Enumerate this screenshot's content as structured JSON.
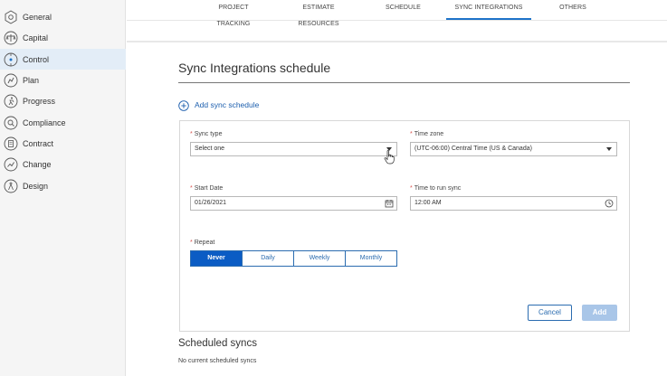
{
  "sidebar": {
    "items": [
      {
        "label": "General",
        "icon": "gear-icon"
      },
      {
        "label": "Capital",
        "icon": "scale-icon"
      },
      {
        "label": "Control",
        "icon": "target-icon",
        "active": true
      },
      {
        "label": "Plan",
        "icon": "route-icon"
      },
      {
        "label": "Progress",
        "icon": "running-icon"
      },
      {
        "label": "Compliance",
        "icon": "search-doc-icon"
      },
      {
        "label": "Contract",
        "icon": "contract-icon"
      },
      {
        "label": "Change",
        "icon": "change-icon"
      },
      {
        "label": "Design",
        "icon": "compass-icon"
      }
    ]
  },
  "tabs": [
    {
      "label": "PROJECT TRACKING"
    },
    {
      "label": "ESTIMATE RESOURCES"
    },
    {
      "label": "SCHEDULE"
    },
    {
      "label": "SYNC INTEGRATIONS",
      "active": true
    },
    {
      "label": "OTHERS"
    }
  ],
  "page": {
    "title": "Sync Integrations schedule",
    "add_label": "Add sync schedule"
  },
  "form": {
    "sync_type": {
      "label": "Sync type",
      "value": "Select one"
    },
    "time_zone": {
      "label": "Time zone",
      "value": "(UTC-06:00) Central Time (US & Canada)"
    },
    "start_date": {
      "label": "Start Date",
      "value": "01/26/2021"
    },
    "time_to_run": {
      "label": "Time to run sync",
      "value": "12:00 AM"
    },
    "repeat": {
      "label": "Repeat",
      "options": [
        "Never",
        "Daily",
        "Weekly",
        "Monthly"
      ],
      "selected": "Never"
    },
    "cancel_label": "Cancel",
    "add_label": "Add"
  },
  "scheduled": {
    "title": "Scheduled syncs",
    "empty_text": "No current scheduled syncs"
  },
  "colors": {
    "accent": "#0b5cc4",
    "link": "#1d5fae",
    "required": "#d9534f",
    "disabled_button": "#a9c6e8"
  }
}
